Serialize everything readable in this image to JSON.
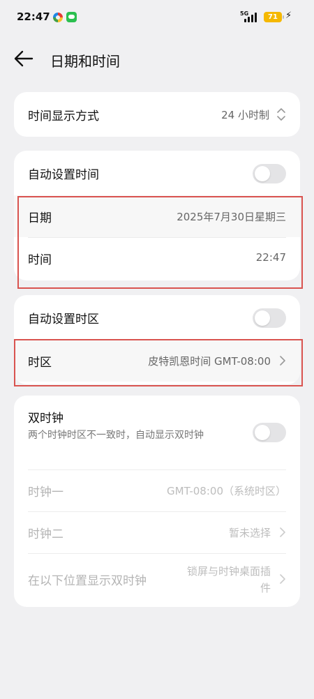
{
  "status_bar": {
    "time": "22:47",
    "network": "5G",
    "battery": "71",
    "icons": [
      "app-icon-colorful",
      "messages-app-icon",
      "signal-icon",
      "battery-icon",
      "charging-bolt-icon"
    ]
  },
  "header": {
    "title": "日期和时间",
    "back_icon": "back-arrow-icon"
  },
  "time_format": {
    "label": "时间显示方式",
    "value": "24 小时制"
  },
  "date_time": {
    "auto_label": "自动设置时间",
    "auto_enabled": false,
    "date_label": "日期",
    "date_value": "2025年7月30日星期三",
    "time_label": "时间",
    "time_value": "22:47"
  },
  "timezone": {
    "auto_label": "自动设置时区",
    "auto_enabled": false,
    "label": "时区",
    "value": "皮特凯恩时间 GMT-08:00"
  },
  "dual_clock": {
    "title": "双时钟",
    "description": "两个时钟时区不一致时，自动显示双时钟",
    "enabled": false,
    "clock1_label": "时钟一",
    "clock1_value": "GMT-08:00（系统时区）",
    "clock2_label": "时钟二",
    "clock2_value": "暂未选择",
    "position_label": "在以下位置显示双时钟",
    "position_value": "锁屏与时钟桌面插件"
  },
  "colors": {
    "background": "#f0f0f2",
    "card": "#ffffff",
    "highlight_box": "#d9534f",
    "battery": "#f5b800"
  }
}
